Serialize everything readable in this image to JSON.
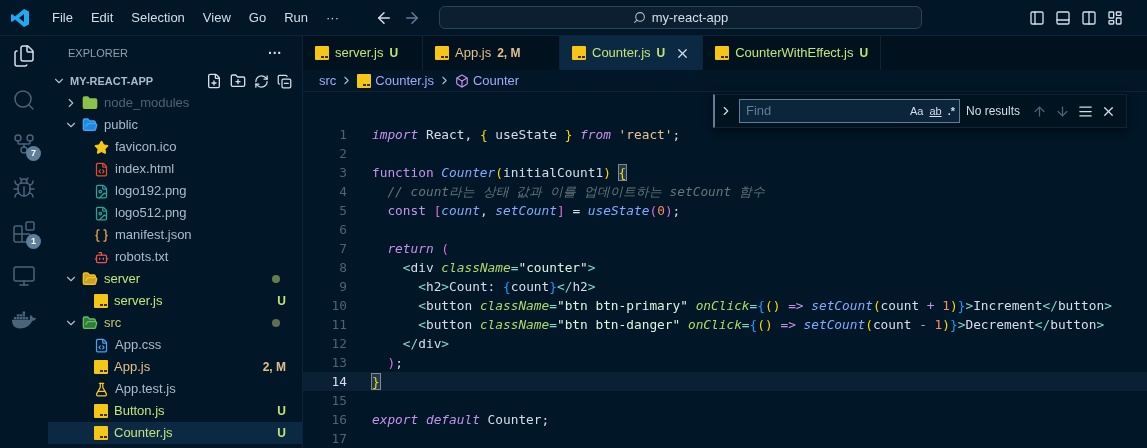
{
  "menu": [
    "File",
    "Edit",
    "Selection",
    "View",
    "Go",
    "Run",
    "···"
  ],
  "command_center": {
    "text": "my-react-app"
  },
  "activity_bar": [
    {
      "kind": "files",
      "selected": true
    },
    {
      "kind": "search",
      "selected": false
    },
    {
      "kind": "source-control",
      "selected": false,
      "badge": "7"
    },
    {
      "kind": "run-debug",
      "selected": false
    },
    {
      "kind": "extensions",
      "selected": false,
      "badge": "1"
    },
    {
      "kind": "remote",
      "selected": false
    },
    {
      "kind": "docker",
      "selected": false
    }
  ],
  "explorer": {
    "title": "EXPLORER",
    "more": "···",
    "project": {
      "name": "MY-REACT-APP",
      "expanded": true
    },
    "tree": [
      {
        "name": "node_modules",
        "kind": "folder-node",
        "color": "#4b6479",
        "dot": false,
        "expanded": false,
        "selected": false
      },
      {
        "name": "public",
        "kind": "folder-public",
        "color": "#a9bccd",
        "dot": false,
        "expanded": true,
        "selected": false,
        "children": [
          {
            "name": "favicon.ico",
            "kind": "star",
            "color": "#a9bccd",
            "selected": false
          },
          {
            "name": "index.html",
            "kind": "html",
            "color": "#a9bccd",
            "selected": false
          },
          {
            "name": "logo192.png",
            "kind": "image",
            "color": "#a9bccd",
            "selected": false
          },
          {
            "name": "logo512.png",
            "kind": "image",
            "color": "#a9bccd",
            "selected": false
          },
          {
            "name": "manifest.json",
            "kind": "json",
            "color": "#a9bccd",
            "selected": false
          },
          {
            "name": "robots.txt",
            "kind": "robot",
            "color": "#a9bccd",
            "selected": false
          }
        ]
      },
      {
        "name": "server",
        "kind": "folder-server",
        "color": "#c5e478",
        "dot": true,
        "expanded": true,
        "selected": false,
        "children": [
          {
            "name": "server.js",
            "kind": "js",
            "color": "#c5e478",
            "badge": "U",
            "selected": false
          }
        ]
      },
      {
        "name": "src",
        "kind": "folder-src",
        "color": "#c5c478",
        "dot": true,
        "expanded": true,
        "selected": false,
        "children": [
          {
            "name": "App.css",
            "kind": "css",
            "color": "#a9bccd",
            "selected": false
          },
          {
            "name": "App.js",
            "kind": "js",
            "color": "#e2c08d",
            "badge": "2, M",
            "selected": false
          },
          {
            "name": "App.test.js",
            "kind": "test",
            "color": "#a9bccd",
            "selected": false
          },
          {
            "name": "Button.js",
            "kind": "js",
            "color": "#c5e478",
            "badge": "U",
            "selected": false
          },
          {
            "name": "Counter.js",
            "kind": "js",
            "color": "#c5e478",
            "badge": "U",
            "selected": true
          }
        ]
      }
    ]
  },
  "tabs": [
    {
      "label": "server.js",
      "badge": "U",
      "color": "#c5e478",
      "selected": false
    },
    {
      "label": "App.js",
      "badge": "2, M",
      "color": "#e2c08d",
      "selected": false
    },
    {
      "label": "Counter.js",
      "badge": "U",
      "color": "#c5e478",
      "selected": true
    },
    {
      "label": "CounterWithEffect.js",
      "badge": "U",
      "color": "#c5e478",
      "selected": false
    }
  ],
  "breadcrumbs": [
    {
      "label": "src",
      "kind": "folder"
    },
    {
      "label": "Counter.js",
      "kind": "js"
    },
    {
      "label": "Counter",
      "kind": "symbol"
    }
  ],
  "find": {
    "placeholder": "Find",
    "options": [
      "Aa",
      "ab",
      ".*"
    ],
    "result": "No results"
  },
  "code": [
    {
      "num": "1",
      "current": false,
      "tokens": [
        {
          "text": "import",
          "kind": "kw"
        },
        {
          "text": " React, ",
          "kind": "id"
        },
        {
          "text": "{",
          "kind": "br"
        },
        {
          "text": " useState ",
          "kind": "id"
        },
        {
          "text": "}",
          "kind": "br"
        },
        {
          "text": " from",
          "kind": "kw"
        },
        {
          "text": " 'react'",
          "kind": "str"
        },
        {
          "text": ";",
          "kind": "id"
        }
      ]
    },
    {
      "num": "2",
      "current": false
    },
    {
      "num": "3",
      "current": false,
      "tokens": [
        {
          "text": "function",
          "kind": "kw2"
        },
        {
          "text": " Counter",
          "kind": "fn"
        },
        {
          "text": "(",
          "kind": "br"
        },
        {
          "text": "initialCount1",
          "kind": "id"
        },
        {
          "text": ") ",
          "kind": "br"
        },
        {
          "text": "{",
          "kind": "brm"
        }
      ]
    },
    {
      "num": "4",
      "current": false,
      "tokens": [
        {
          "text": "  // count라는 상태 값과 이를 업데이트하는 setCount 함수",
          "kind": "cmt"
        }
      ]
    },
    {
      "num": "5",
      "current": false,
      "tokens": [
        {
          "text": "  const",
          "kind": "kw2"
        },
        {
          "text": " [",
          "kind": "br2"
        },
        {
          "text": "count",
          "kind": "var"
        },
        {
          "text": ", ",
          "kind": "id"
        },
        {
          "text": "setCount",
          "kind": "var"
        },
        {
          "text": "]",
          "kind": "br2"
        },
        {
          "text": " = ",
          "kind": "id"
        },
        {
          "text": "useState",
          "kind": "fn"
        },
        {
          "text": "(",
          "kind": "br2"
        },
        {
          "text": "0",
          "kind": "num"
        },
        {
          "text": ")",
          "kind": "br2"
        },
        {
          "text": ";",
          "kind": "id"
        }
      ]
    },
    {
      "num": "6",
      "current": false
    },
    {
      "num": "7",
      "current": false,
      "tokens": [
        {
          "text": "  return",
          "kind": "kw"
        },
        {
          "text": " (",
          "kind": "br2"
        }
      ]
    },
    {
      "num": "8",
      "current": false,
      "tokens": [
        {
          "text": "    <",
          "kind": "tag"
        },
        {
          "text": "div",
          "kind": "id"
        },
        {
          "text": " className",
          "kind": "attr"
        },
        {
          "text": "=",
          "kind": "tag"
        },
        {
          "text": "\"counter\"",
          "kind": "jsx"
        },
        {
          "text": ">",
          "kind": "tag"
        }
      ]
    },
    {
      "num": "9",
      "current": false,
      "tokens": [
        {
          "text": "      <",
          "kind": "tag"
        },
        {
          "text": "h2",
          "kind": "id"
        },
        {
          "text": ">",
          "kind": "tag"
        },
        {
          "text": "Count: ",
          "kind": "id"
        },
        {
          "text": "{",
          "kind": "br3"
        },
        {
          "text": "count",
          "kind": "id"
        },
        {
          "text": "}",
          "kind": "br3"
        },
        {
          "text": "</",
          "kind": "tag"
        },
        {
          "text": "h2",
          "kind": "id"
        },
        {
          "text": ">",
          "kind": "tag"
        }
      ]
    },
    {
      "num": "10",
      "current": false,
      "tokens": [
        {
          "text": "      <",
          "kind": "tag"
        },
        {
          "text": "button",
          "kind": "id"
        },
        {
          "text": " className",
          "kind": "attr"
        },
        {
          "text": "=",
          "kind": "tag"
        },
        {
          "text": "\"btn btn-primary\"",
          "kind": "jsx"
        },
        {
          "text": " onClick",
          "kind": "attr"
        },
        {
          "text": "=",
          "kind": "tag"
        },
        {
          "text": "{",
          "kind": "br3"
        },
        {
          "text": "()",
          "kind": "br"
        },
        {
          "text": " => ",
          "kind": "kw2"
        },
        {
          "text": "setCount",
          "kind": "fn"
        },
        {
          "text": "(",
          "kind": "br"
        },
        {
          "text": "count ",
          "kind": "id"
        },
        {
          "text": "+ ",
          "kind": "kw2"
        },
        {
          "text": "1",
          "kind": "num"
        },
        {
          "text": ")",
          "kind": "br"
        },
        {
          "text": "}",
          "kind": "br3"
        },
        {
          "text": ">",
          "kind": "tag"
        },
        {
          "text": "Increment",
          "kind": "id"
        },
        {
          "text": "</",
          "kind": "tag"
        },
        {
          "text": "button",
          "kind": "id"
        },
        {
          "text": ">",
          "kind": "tag"
        }
      ]
    },
    {
      "num": "11",
      "current": false,
      "tokens": [
        {
          "text": "      <",
          "kind": "tag"
        },
        {
          "text": "button",
          "kind": "id"
        },
        {
          "text": " className",
          "kind": "attr"
        },
        {
          "text": "=",
          "kind": "tag"
        },
        {
          "text": "\"btn btn-danger\"",
          "kind": "jsx"
        },
        {
          "text": " onClick",
          "kind": "attr"
        },
        {
          "text": "=",
          "kind": "tag"
        },
        {
          "text": "{",
          "kind": "br3"
        },
        {
          "text": "()",
          "kind": "br"
        },
        {
          "text": " => ",
          "kind": "kw2"
        },
        {
          "text": "setCount",
          "kind": "fn"
        },
        {
          "text": "(",
          "kind": "br"
        },
        {
          "text": "count ",
          "kind": "id"
        },
        {
          "text": "- ",
          "kind": "kw2"
        },
        {
          "text": "1",
          "kind": "num"
        },
        {
          "text": ")",
          "kind": "br"
        },
        {
          "text": "}",
          "kind": "br3"
        },
        {
          "text": ">",
          "kind": "tag"
        },
        {
          "text": "Decrement",
          "kind": "id"
        },
        {
          "text": "</",
          "kind": "tag"
        },
        {
          "text": "button",
          "kind": "id"
        },
        {
          "text": ">",
          "kind": "tag"
        }
      ]
    },
    {
      "num": "12",
      "current": false,
      "tokens": [
        {
          "text": "    </",
          "kind": "tag"
        },
        {
          "text": "div",
          "kind": "id"
        },
        {
          "text": ">",
          "kind": "tag"
        }
      ]
    },
    {
      "num": "13",
      "current": false,
      "tokens": [
        {
          "text": "  )",
          "kind": "br2"
        },
        {
          "text": ";",
          "kind": "id"
        }
      ]
    },
    {
      "num": "14",
      "current": true,
      "tokens": [
        {
          "text": "}",
          "kind": "brm"
        }
      ]
    },
    {
      "num": "15",
      "current": false
    },
    {
      "num": "16",
      "current": false,
      "tokens": [
        {
          "text": "export default",
          "kind": "kw"
        },
        {
          "text": " Counter;",
          "kind": "id"
        }
      ]
    },
    {
      "num": "17",
      "current": false
    }
  ]
}
